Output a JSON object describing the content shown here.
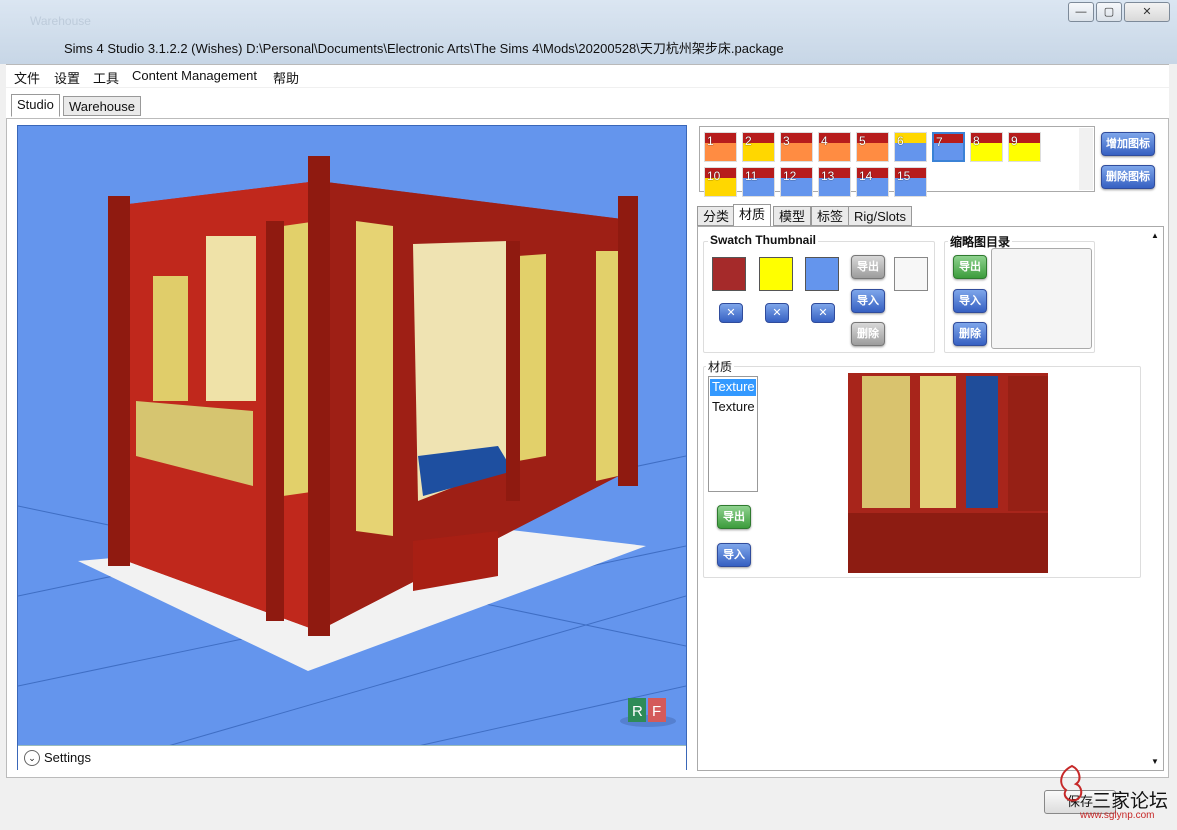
{
  "window": {
    "ghost_title": "Warehouse",
    "title": "Sims 4 Studio 3.1.2.2 (Wishes)  D:\\Personal\\Documents\\Electronic Arts\\The Sims 4\\Mods\\20200528\\天刀杭州架步床.package",
    "minimize": "—",
    "maximize": "▢",
    "close": "✕"
  },
  "menu": [
    "文件",
    "设置",
    "工具",
    "Content Management",
    "帮助"
  ],
  "main_tabs": [
    "Studio",
    "Warehouse"
  ],
  "viewport": {
    "settings_label": "Settings",
    "logo_r": "R",
    "logo_f": "F"
  },
  "swatches": {
    "items": [
      {
        "num": "1",
        "top": "#b71c1c",
        "bottom": "#ff8c42"
      },
      {
        "num": "2",
        "top": "#b71c1c",
        "bottom": "#ffd700"
      },
      {
        "num": "3",
        "top": "#b71c1c",
        "bottom": "#ff8c42"
      },
      {
        "num": "4",
        "top": "#b71c1c",
        "bottom": "#ff8c42"
      },
      {
        "num": "5",
        "top": "#b71c1c",
        "bottom": "#ff8c42"
      },
      {
        "num": "6",
        "top": "#ffd700",
        "bottom": "#6495ed"
      },
      {
        "num": "7",
        "top": "#b71c1c",
        "bottom": "#6495ed"
      },
      {
        "num": "8",
        "top": "#b71c1c",
        "bottom": "#ffff00"
      },
      {
        "num": "9",
        "top": "#b71c1c",
        "bottom": "#ffff00"
      },
      {
        "num": "10",
        "top": "#b71c1c",
        "bottom": "#ffd700"
      },
      {
        "num": "11",
        "top": "#b71c1c",
        "bottom": "#6495ed"
      },
      {
        "num": "12",
        "top": "#b71c1c",
        "bottom": "#6495ed"
      },
      {
        "num": "13",
        "top": "#b71c1c",
        "bottom": "#6495ed"
      },
      {
        "num": "14",
        "top": "#b71c1c",
        "bottom": "#6495ed"
      },
      {
        "num": "15",
        "top": "#b71c1c",
        "bottom": "#6495ed"
      }
    ],
    "selected_index": 6,
    "add_label": "增加图标",
    "remove_label": "删除图标"
  },
  "sub_tabs": [
    "分类",
    "材质",
    "模型",
    "标签",
    "Rig/Slots"
  ],
  "swatch_thumbnail": {
    "title": "Swatch Thumbnail",
    "colors": [
      "#a52a2a",
      "#ffff00",
      "#6495ed"
    ],
    "export_label": "导出",
    "import_label": "导入",
    "delete_label": "删除",
    "remove_color_label": "✕"
  },
  "thumbnail_dir": {
    "title": "缩略图目录",
    "export_label": "导出",
    "import_label": "导入",
    "delete_label": "删除"
  },
  "material": {
    "title": "材质",
    "items": [
      "Texture",
      "Texture"
    ],
    "selected_index": 0,
    "export_label": "导出",
    "import_label": "导入"
  },
  "footer": {
    "save_label": "保存",
    "watermark_text": "三家论坛",
    "watermark_url": "www.sglynp.com"
  }
}
